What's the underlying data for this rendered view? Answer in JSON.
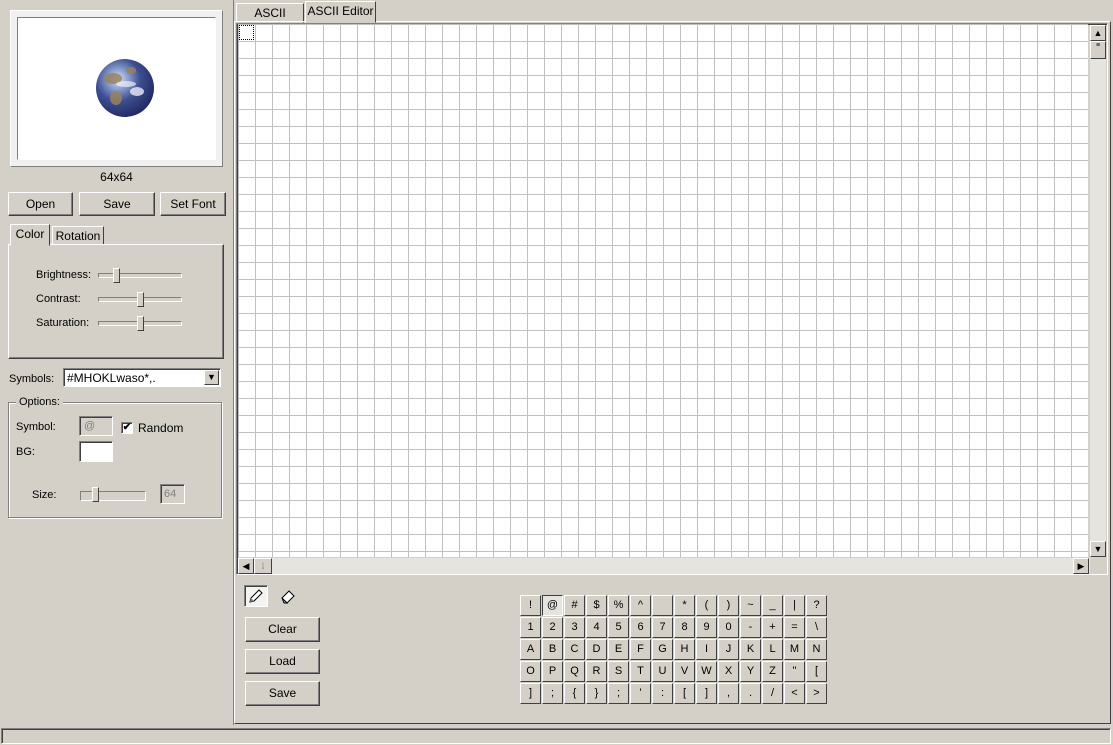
{
  "preview": {
    "size_label": "64x64"
  },
  "file_buttons": {
    "open": "Open",
    "save": "Save",
    "set_font": "Set Font"
  },
  "adjust_tabs": {
    "color": "Color",
    "rotation": "Rotation"
  },
  "adjustments": {
    "brightness_label": "Brightness:",
    "contrast_label": "Contrast:",
    "saturation_label": "Saturation:",
    "brightness_level": 0.2,
    "contrast_level": 0.5,
    "saturation_level": 0.5
  },
  "symbols": {
    "label": "Symbols:",
    "value": "#MHOKLwaso*,."
  },
  "options": {
    "group_label": "Options:",
    "symbol_label": "Symbol:",
    "symbol_value": "@",
    "random_label": "Random",
    "random_checked": true,
    "bg_label": "BG:",
    "size_label": "Size:",
    "size_value": "64",
    "size_level": 0.2
  },
  "main_tabs": {
    "ascii_image": "ASCII Image",
    "ascii_editor": "ASCII Editor"
  },
  "editor_buttons": {
    "clear": "Clear",
    "load": "Load",
    "save": "Save"
  },
  "tools": {
    "pencil": "pencil-icon",
    "eraser": "eraser-icon"
  },
  "keyboard": {
    "selected": "@",
    "rows": [
      [
        "!",
        "@",
        "#",
        "$",
        "%",
        "^",
        "",
        "*",
        "(",
        ")",
        "~",
        "_",
        "|",
        "?"
      ],
      [
        "1",
        "2",
        "3",
        "4",
        "5",
        "6",
        "7",
        "8",
        "9",
        "0",
        "-",
        "+",
        "=",
        "\\"
      ],
      [
        "A",
        "B",
        "C",
        "D",
        "E",
        "F",
        "G",
        "H",
        "I",
        "J",
        "K",
        "L",
        "M",
        "N"
      ],
      [
        "O",
        "P",
        "Q",
        "R",
        "S",
        "T",
        "U",
        "V",
        "W",
        "X",
        "Y",
        "Z",
        "\"",
        "["
      ],
      [
        "]",
        ";",
        "{",
        "}",
        ";",
        "'",
        ":",
        "[",
        "]",
        ",",
        ".",
        "/",
        "<",
        ">"
      ]
    ]
  }
}
